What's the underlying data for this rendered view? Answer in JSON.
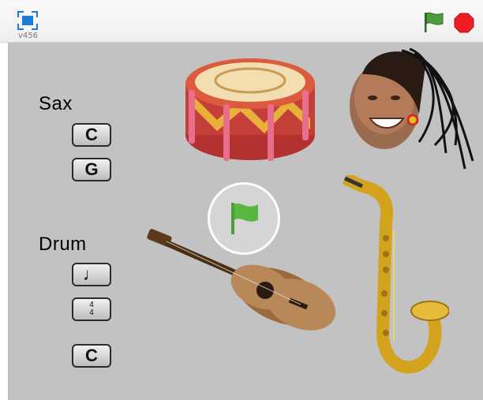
{
  "toolbar": {
    "version": "v456",
    "icons": [
      "fullscreen-icon",
      "green-flag-icon",
      "stop-icon"
    ]
  },
  "stage": {
    "sax_label": "Sax",
    "sax_keys": [
      "C",
      "G"
    ],
    "drum_label": "Drum",
    "drum_keys": [
      "♩",
      "4|4",
      "C"
    ],
    "colors": {
      "stage_bg": "#c2c2c2",
      "flag_green": "#4c9c3c",
      "stop_red": "#ee1c24",
      "fullscreen_blue": "#1f7ad6"
    }
  }
}
